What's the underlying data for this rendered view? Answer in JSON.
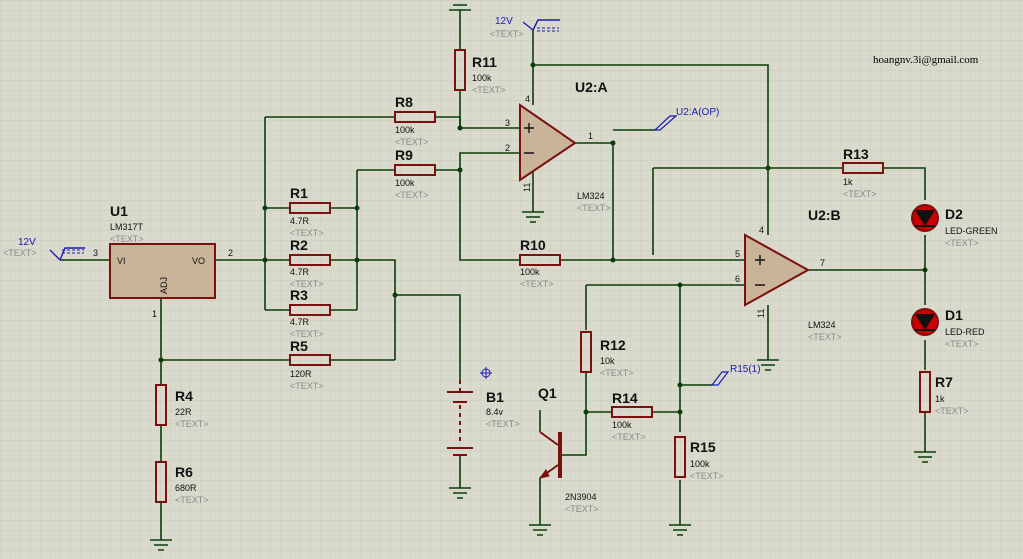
{
  "author_email": "hoangnv.3i@gmail.com",
  "placeholder": "<TEXT>",
  "terminals": {
    "vin": "12V",
    "vcc": "12V",
    "op_out": "U2:A(OP)",
    "r15_probe": "R15(1)"
  },
  "u1": {
    "ref": "U1",
    "part": "LM317T",
    "pin_vi": "VI",
    "pin_vo": "VO",
    "pin_adj": "ADJ",
    "pin_num_vi": "3",
    "pin_num_vo": "2",
    "pin_num_adj": "1"
  },
  "u2a": {
    "ref": "U2:A",
    "part": "LM324",
    "pin_plus": "3",
    "pin_minus": "2",
    "pin_out": "1",
    "pin_vcc": "4",
    "pin_gnd": "11"
  },
  "u2b": {
    "ref": "U2:B",
    "part": "LM324",
    "pin_plus": "5",
    "pin_minus": "6",
    "pin_out": "7",
    "pin_vcc": "4",
    "pin_gnd": "11"
  },
  "resistors": {
    "r1": {
      "ref": "R1",
      "value": "4.7R"
    },
    "r2": {
      "ref": "R2",
      "value": "4.7R"
    },
    "r3": {
      "ref": "R3",
      "value": "4.7R"
    },
    "r4": {
      "ref": "R4",
      "value": "22R"
    },
    "r5": {
      "ref": "R5",
      "value": "120R"
    },
    "r6": {
      "ref": "R6",
      "value": "680R"
    },
    "r7": {
      "ref": "R7",
      "value": "1k"
    },
    "r8": {
      "ref": "R8",
      "value": "100k"
    },
    "r9": {
      "ref": "R9",
      "value": "100k"
    },
    "r10": {
      "ref": "R10",
      "value": "100k"
    },
    "r11": {
      "ref": "R11",
      "value": "100k"
    },
    "r12": {
      "ref": "R12",
      "value": "10k"
    },
    "r13": {
      "ref": "R13",
      "value": "1k"
    },
    "r14": {
      "ref": "R14",
      "value": "100k"
    },
    "r15": {
      "ref": "R15",
      "value": "100k"
    }
  },
  "b1": {
    "ref": "B1",
    "value": "8.4v"
  },
  "q1": {
    "ref": "Q1",
    "value": "2N3904"
  },
  "d1": {
    "ref": "D1",
    "value": "LED-RED"
  },
  "d2": {
    "ref": "D2",
    "value": "LED-GREEN"
  },
  "colors": {
    "background": "#d9d9cc",
    "grid": "#c6c6b9",
    "wire": "#0a3d0a",
    "component": "#7a1010",
    "led": "#cc0000"
  }
}
